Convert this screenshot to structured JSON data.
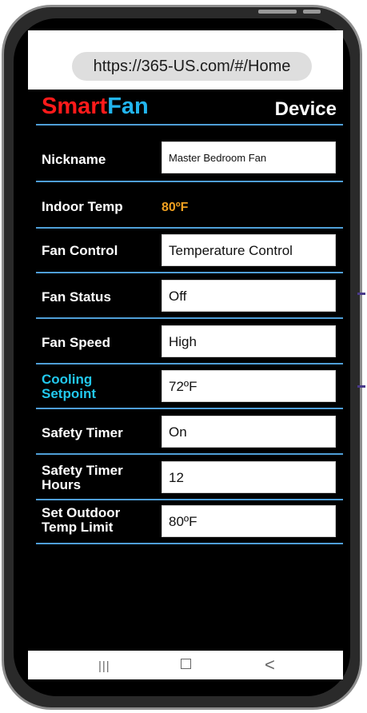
{
  "browser": {
    "url": "https://365-US.com/#/Home"
  },
  "header": {
    "brand_part1": "Smart",
    "brand_part2": "Fan",
    "page_title": "Device"
  },
  "rows": {
    "nickname": {
      "label": "Nickname",
      "value": "Master Bedroom Fan"
    },
    "indoor_temp": {
      "label": "Indoor Temp",
      "value": "80ºF"
    },
    "fan_control": {
      "label": "Fan Control",
      "value": "Temperature Control"
    },
    "fan_status": {
      "label": "Fan Status",
      "value": "Off"
    },
    "fan_speed": {
      "label": "Fan Speed",
      "value": "High"
    },
    "cooling_setpoint": {
      "label_line1": "Cooling",
      "label_line2": "Setpoint",
      "value": "72ºF"
    },
    "safety_timer": {
      "label": "Safety Timer",
      "value": "On"
    },
    "safety_timer_hours": {
      "label_line1": "Safety Timer",
      "label_line2": "Hours",
      "value": "12"
    },
    "outdoor_temp_limit": {
      "label_line1": "Set Outdoor",
      "label_line2": "Temp Limit",
      "value": "80ºF"
    }
  },
  "navbar": {
    "recents_glyph": "|||",
    "back_glyph": "<"
  },
  "colors": {
    "brand_red": "#ff1a1a",
    "brand_blue": "#22b5ee",
    "divider": "#4f9fd8",
    "temp_orange": "#f0a020",
    "accent_cyan": "#22c8ee"
  }
}
